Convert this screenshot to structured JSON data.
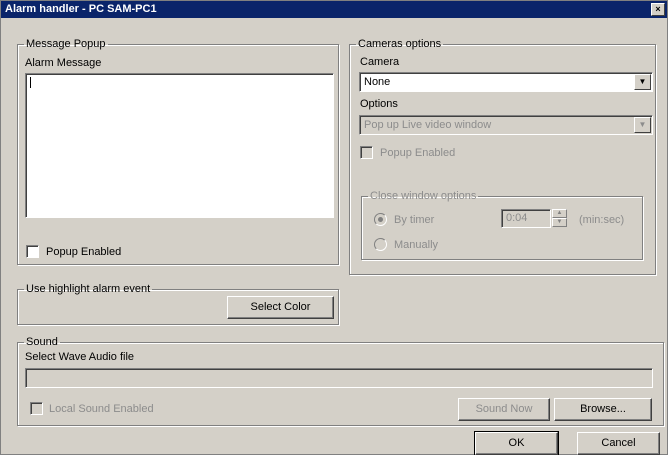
{
  "window": {
    "title": "Alarm handler - PC SAM-PC1",
    "close_glyph": "×"
  },
  "message_popup": {
    "group_label": "Message Popup",
    "alarm_message_label": "Alarm Message",
    "alarm_message_value": "",
    "popup_enabled_label": "Popup Enabled",
    "popup_enabled_checked": false
  },
  "cameras": {
    "group_label": "Cameras options",
    "camera_label": "Camera",
    "camera_value": "None",
    "options_label": "Options",
    "options_value": "Pop up Live video window",
    "popup_enabled_label": "Popup Enabled",
    "close_window": {
      "group_label": "Close window options",
      "by_timer_label": "By timer",
      "manually_label": "Manually",
      "timer_value": "0:04",
      "timer_unit": "(min:sec)",
      "selected": "By timer"
    }
  },
  "highlight": {
    "group_label": "Use highlight alarm event",
    "select_color_label": "Select Color"
  },
  "sound": {
    "group_label": "Sound",
    "wave_label": "Select Wave Audio file",
    "wave_value": "",
    "local_sound_label": "Local Sound Enabled",
    "sound_now_label": "Sound Now",
    "browse_label": "Browse..."
  },
  "footer": {
    "ok_label": "OK",
    "cancel_label": "Cancel"
  },
  "icons": {
    "dropdown": "chevron-down-icon",
    "spin_up": "▲",
    "spin_down": "▼",
    "arrow": "▼"
  }
}
